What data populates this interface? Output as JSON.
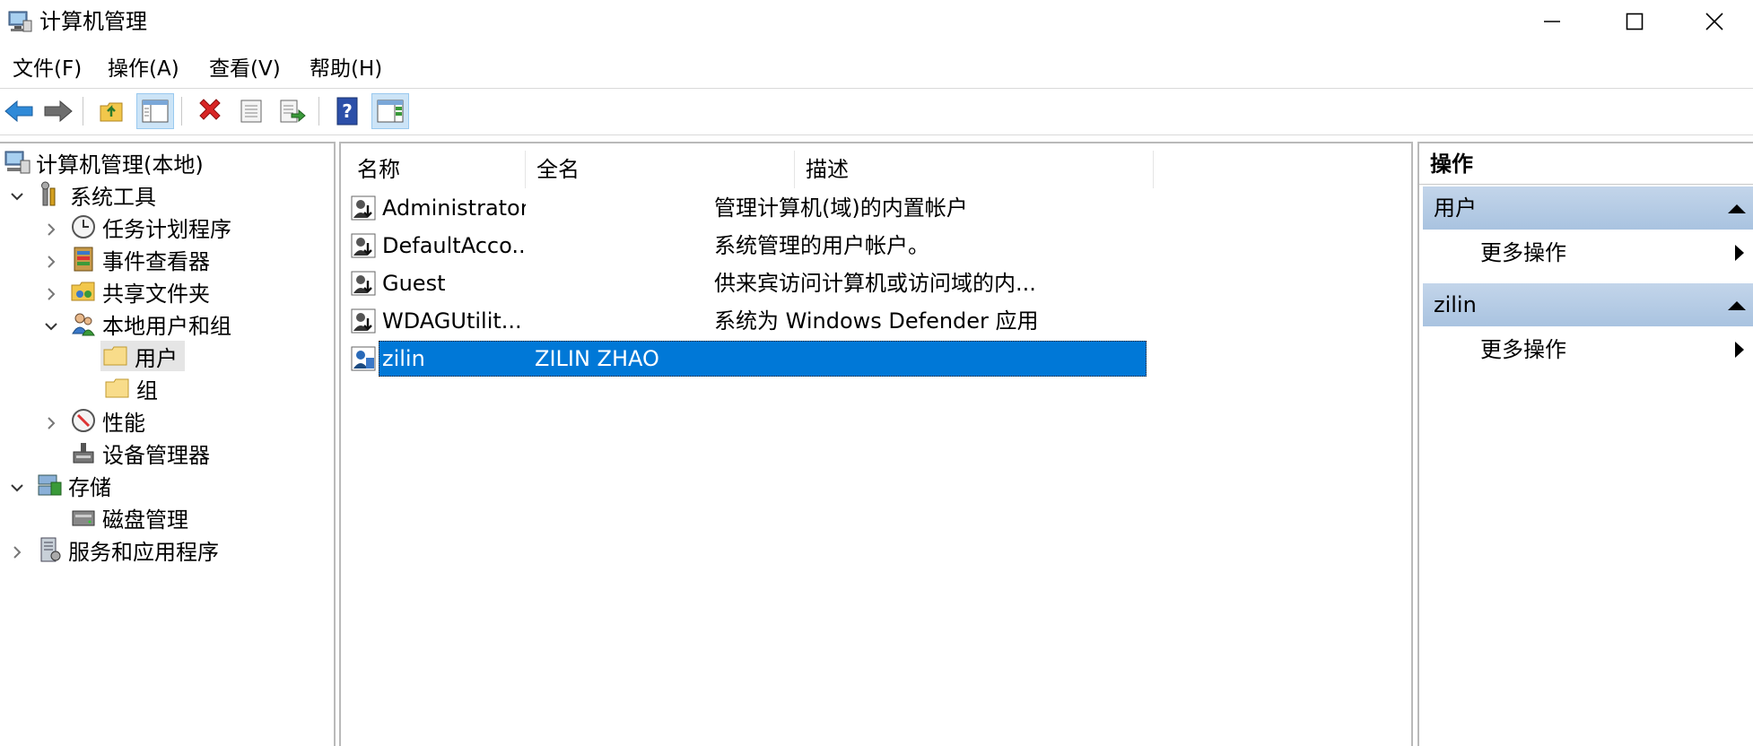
{
  "window": {
    "title": "计算机管理",
    "minimize_icon": "minimize-icon",
    "maximize_icon": "maximize-icon",
    "close_icon": "close-icon"
  },
  "menu": [
    "文件(F)",
    "操作(A)",
    "查看(V)",
    "帮助(H)"
  ],
  "toolbar_icons": [
    "back-arrow-icon",
    "forward-arrow-icon",
    "up-folder-icon",
    "show-hide-tree-icon",
    "delete-icon",
    "properties-icon",
    "export-list-icon",
    "help-icon",
    "show-action-pane-icon"
  ],
  "tree": {
    "root": "计算机管理(本地)",
    "system_tools": "系统工具",
    "task_scheduler": "任务计划程序",
    "event_viewer": "事件查看器",
    "shared_folders": "共享文件夹",
    "local_users_groups": "本地用户和组",
    "users": "用户",
    "groups": "组",
    "performance": "性能",
    "device_manager": "设备管理器",
    "storage": "存储",
    "disk_management": "磁盘管理",
    "services_apps": "服务和应用程序"
  },
  "list": {
    "columns": [
      "名称",
      "全名",
      "描述"
    ],
    "rows": [
      {
        "name": "Administrator",
        "fullname": "",
        "description": "管理计算机(域)的内置帐户"
      },
      {
        "name": "DefaultAcco...",
        "fullname": "",
        "description": "系统管理的用户帐户。"
      },
      {
        "name": "Guest",
        "fullname": "",
        "description": "供来宾访问计算机或访问域的内..."
      },
      {
        "name": "WDAGUtilit...",
        "fullname": "",
        "description": "系统为 Windows Defender 应用..."
      },
      {
        "name": "zilin",
        "fullname": "ZILIN ZHAO",
        "description": ""
      }
    ],
    "selected_index": 4
  },
  "actions": {
    "header": "操作",
    "sections": [
      {
        "title": "用户",
        "item": "更多操作"
      },
      {
        "title": "zilin",
        "item": "更多操作"
      }
    ]
  },
  "colors": {
    "selection": "#0078d7",
    "action_section": "#b7cde6"
  }
}
